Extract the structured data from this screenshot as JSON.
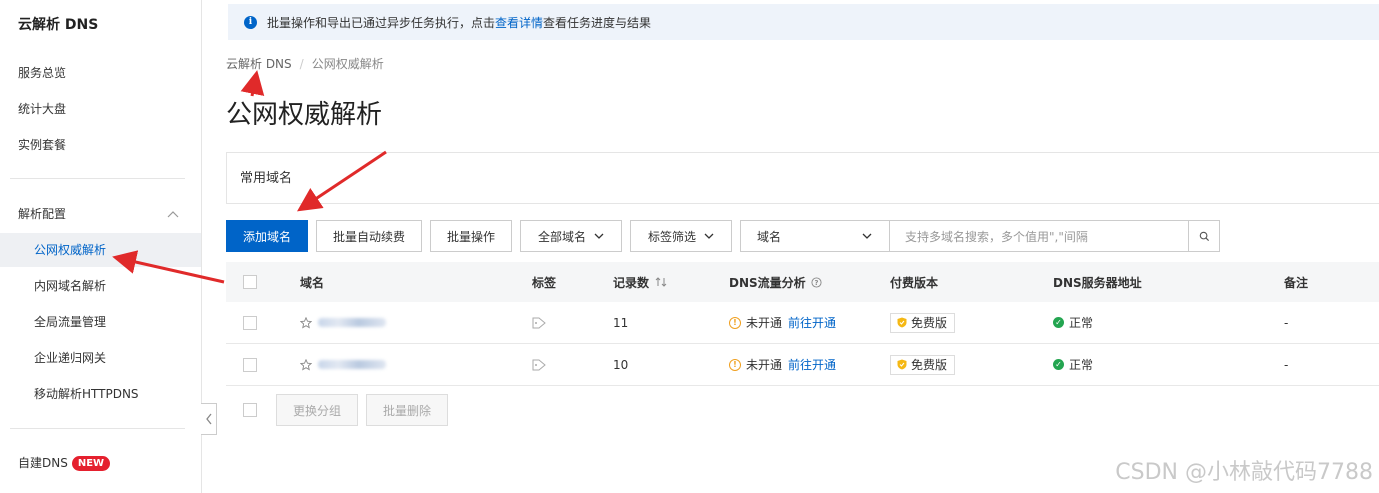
{
  "sidebar": {
    "title": "云解析 DNS",
    "items": [
      {
        "label": "服务总览"
      },
      {
        "label": "统计大盘"
      },
      {
        "label": "实例套餐"
      }
    ],
    "group": {
      "label": "解析配置"
    },
    "sub_items": [
      {
        "label": "公网权威解析",
        "active": true
      },
      {
        "label": "内网域名解析"
      },
      {
        "label": "全局流量管理"
      },
      {
        "label": "企业递归网关"
      },
      {
        "label": "移动解析HTTPDNS"
      }
    ],
    "footer_item": {
      "label": "自建DNS",
      "badge": "NEW"
    }
  },
  "notice": {
    "text_before": "批量操作和导出已通过异步任务执行，点击",
    "link": "查看详情",
    "text_after": "查看任务进度与结果"
  },
  "breadcrumb": [
    "云解析 DNS",
    "公网权威解析"
  ],
  "page_title": "公网权威解析",
  "common_domains": {
    "label": "常用域名"
  },
  "toolbar": {
    "add_domain": "添加域名",
    "batch_renew": "批量自动续费",
    "batch_ops": "批量操作",
    "all_domains": "全部域名",
    "tag_filter": "标签筛选",
    "search_field": "域名",
    "search_placeholder": "支持多域名搜索，多个值用\",\"间隔"
  },
  "table": {
    "headers": {
      "domain": "域名",
      "tags": "标签",
      "records": "记录数",
      "traffic": "DNS流量分析",
      "edition": "付费版本",
      "dns_server": "DNS服务器地址",
      "remark": "备注"
    },
    "rows": [
      {
        "records": "11",
        "traffic_status": "未开通",
        "traffic_link": "前往开通",
        "edition": "免费版",
        "dns_status": "正常",
        "remark": "-"
      },
      {
        "records": "10",
        "traffic_status": "未开通",
        "traffic_link": "前往开通",
        "edition": "免费版",
        "dns_status": "正常",
        "remark": "-"
      }
    ]
  },
  "footer_actions": {
    "change_group": "更换分组",
    "batch_delete": "批量删除"
  },
  "watermark": "CSDN @小林敲代码7788",
  "colors": {
    "primary": "#0064c8",
    "annotation_arrow": "#e02a2a",
    "success": "#23a550",
    "warning": "#f0a020"
  }
}
